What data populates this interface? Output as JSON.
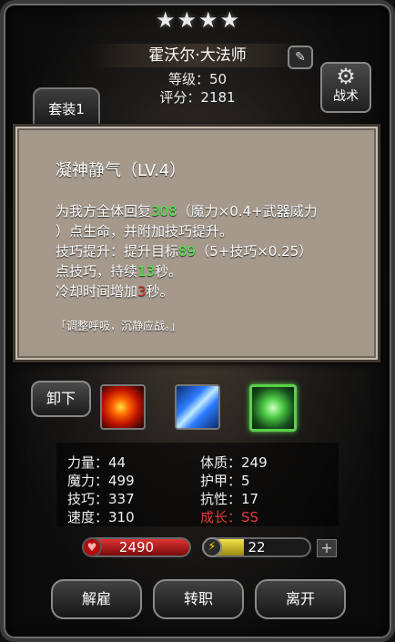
{
  "header": {
    "stars": [
      "★",
      "★",
      "★",
      "★"
    ],
    "name": "霍沃尔·大法师",
    "edit_icon": "✎",
    "level": "等级：50",
    "score": "评分：2181"
  },
  "set_tab": {
    "label": "套装1"
  },
  "tactic_button": {
    "icon": "⚙",
    "label": "战术"
  },
  "tooltip": {
    "title": "凝神静气（LV.4）",
    "line1_a": "为我方全体回复",
    "line1_value": "308",
    "line1_b": "（魔力×0.4+武器威力",
    "line2": "）点生命，并附加技巧提升。",
    "line3_a": "技巧提升：提升目标",
    "line3_value": "89",
    "line3_b": "（5+技巧×0.25）",
    "line4_a": "点技巧，持续",
    "line4_value": "13",
    "line4_b": "秒。",
    "line5_a": "冷却时间增加",
    "line5_value": "3",
    "line5_b": "秒。",
    "quote": "「调整呼吸，沉静应战。」"
  },
  "skills": {
    "unequip_label": "卸下"
  },
  "stats": {
    "strength": "力量：44",
    "constitution": "体质：249",
    "magic": "魔力：499",
    "armor": "护甲：5",
    "skill": "技巧：337",
    "resistance": "抗性：17",
    "speed": "速度：310",
    "growth": "成长：SS"
  },
  "bars": {
    "hp_icon": "♥",
    "hp": "2490",
    "energy_icon": "⚡",
    "energy": "22",
    "energy_fill": 0.38,
    "plus_label": "+"
  },
  "buttons": {
    "dismiss": "解雇",
    "transfer": "转职",
    "leave": "离开"
  },
  "colors": {
    "green_value": "#4cf04c",
    "red_value": "#d63232",
    "growth": "#e23a3a"
  }
}
